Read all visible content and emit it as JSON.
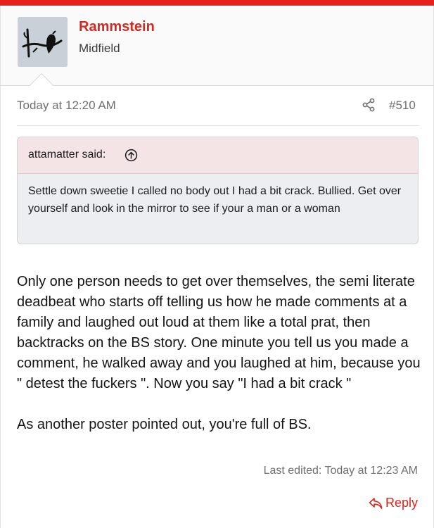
{
  "colors": {
    "accent": "#e8201c",
    "username": "#d7281f",
    "quote_header_bg": "#f5e4e6",
    "quote_body_bg": "#eceef1",
    "muted_text": "#6f6f6f"
  },
  "author": {
    "username": "Rammstein",
    "title": "Midfield",
    "avatar_icon": "bird-on-branch-avatar"
  },
  "post": {
    "date": "Today at 12:20 AM",
    "share_icon": "share-icon",
    "number": "#510"
  },
  "quote": {
    "author": "attamatter said:",
    "jump_icon": "arrow-up-circle-icon",
    "text": "Settle down sweetie I called no body out I had a bit crack. Bullied. Get over yourself and look in the mirror to see if your a man or a woman"
  },
  "message": {
    "paragraphs": [
      "Only one person needs to get over themselves, the semi literate deadbeat who starts off telling us how he made comments at a family and laughed out loud at them like a total prat, then backtracks on the BS story. One minute you tell us you made a comment, he walked away and you laughed at him, because you \" detest the fuckers \". Now you say \"I had a bit crack \"",
      "As another poster pointed out, you're full of BS."
    ]
  },
  "footer": {
    "last_edited": "Last edited: Today at 12:23 AM",
    "reply_label": "Reply",
    "reply_icon": "reply-arrow-icon"
  }
}
